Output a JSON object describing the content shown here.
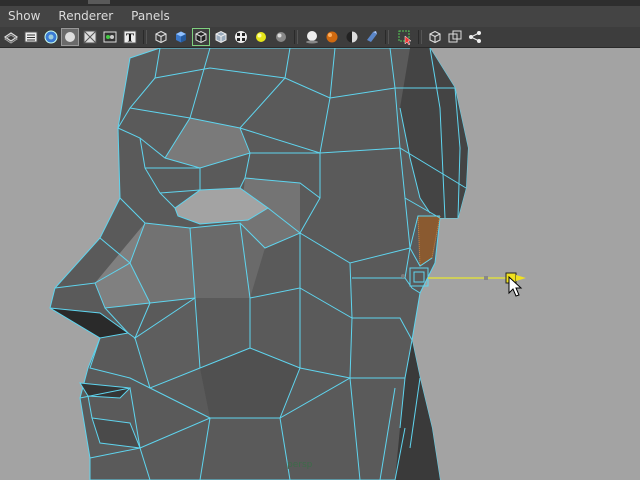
{
  "menubar": {
    "items": [
      "Show",
      "Renderer",
      "Panels"
    ]
  },
  "toolbar": {
    "icons": [
      "select-camera-icon",
      "camera-attributes-icon",
      "bookmark-icon",
      "image-plane-icon",
      "grid-icon",
      "resolution-gate-icon",
      "texture-icon",
      "text-icon",
      "wireframe-cube-icon",
      "smooth-shade-cube-icon",
      "wireframe-on-shaded-icon",
      "xray-cube-icon",
      "textured-icon",
      "lighting-icon",
      "shadows-icon",
      "sphere-light-icon",
      "sphere-hardware-icon",
      "sphere-contrast-icon",
      "sphere-ambient-icon",
      "isolate-select-icon",
      "cube-wire-icon",
      "cube-duplicate-icon",
      "share-node-icon"
    ]
  },
  "viewport": {
    "background": "#a3a3a3",
    "wire_color": "#5fd4ee",
    "camera_label": "persp"
  }
}
